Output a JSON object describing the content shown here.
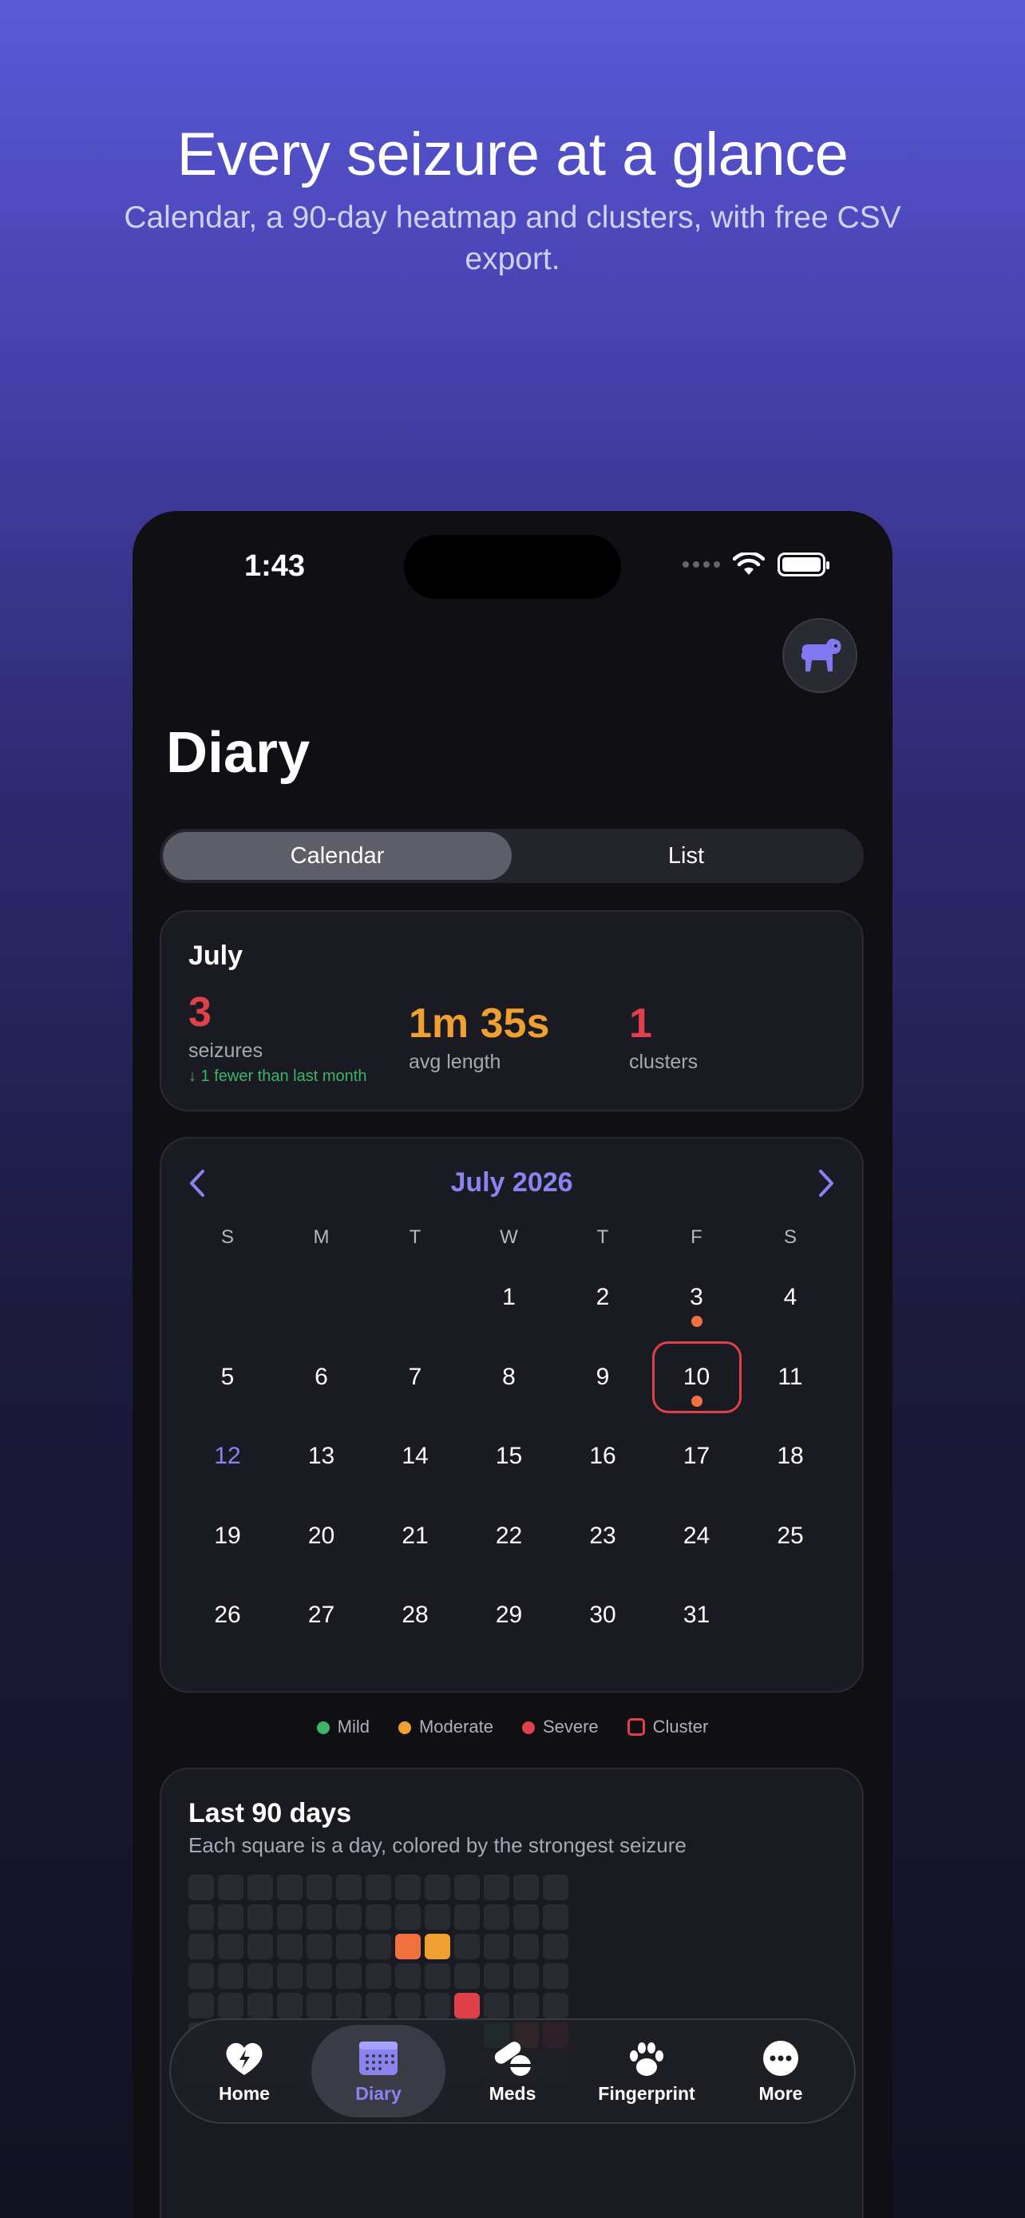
{
  "hero": {
    "title": "Every seizure at a glance",
    "subtitle": "Calendar, a 90-day heatmap and clusters, with free CSV export."
  },
  "status": {
    "time": "1:43"
  },
  "page": {
    "title": "Diary"
  },
  "segmented": {
    "options": [
      "Calendar",
      "List"
    ],
    "selected": "Calendar"
  },
  "summary": {
    "month": "July",
    "stats": [
      {
        "value": "3",
        "label": "seizures",
        "delta": "↓ 1 fewer than last month",
        "color": "#e0404a"
      },
      {
        "value": "1m 35s",
        "label": "avg length",
        "color": "#f0a030"
      },
      {
        "value": "1",
        "label": "clusters",
        "color": "#e0404a"
      }
    ]
  },
  "calendar": {
    "title": "July 2026",
    "weekdays": [
      "S",
      "M",
      "T",
      "W",
      "T",
      "F",
      "S"
    ],
    "first_weekday_index": 3,
    "days_in_month": 31,
    "today": 12,
    "event_days": [
      3,
      10
    ],
    "cluster_days": [
      10
    ]
  },
  "legend": [
    {
      "label": "Mild",
      "color": "#3cb46a"
    },
    {
      "label": "Moderate",
      "color": "#f0a030"
    },
    {
      "label": "Severe",
      "color": "#e0404a"
    },
    {
      "label": "Cluster",
      "color": "#e0404a",
      "shape": "square-outline"
    }
  ],
  "heatmap": {
    "title": "Last 90 days",
    "subtitle": "Each square is a day, colored by the strongest seizure",
    "rows": 7,
    "cols": 13,
    "colored": [
      {
        "row": 2,
        "col": 7,
        "color": "#f07040"
      },
      {
        "row": 2,
        "col": 8,
        "color": "#f0a030"
      },
      {
        "row": 4,
        "col": 9,
        "color": "#e0404a"
      },
      {
        "row": 5,
        "col": 10,
        "color": "#3cb46a"
      },
      {
        "row": 5,
        "col": 11,
        "color": "#f07040"
      },
      {
        "row": 5,
        "col": 12,
        "color": "#e0404a"
      }
    ]
  },
  "tabs": [
    {
      "label": "Home",
      "icon": "heart-bolt-icon"
    },
    {
      "label": "Diary",
      "icon": "calendar-icon",
      "active": true
    },
    {
      "label": "Meds",
      "icon": "pills-icon"
    },
    {
      "label": "Fingerprint",
      "icon": "paw-icon"
    },
    {
      "label": "More",
      "icon": "more-icon"
    }
  ]
}
